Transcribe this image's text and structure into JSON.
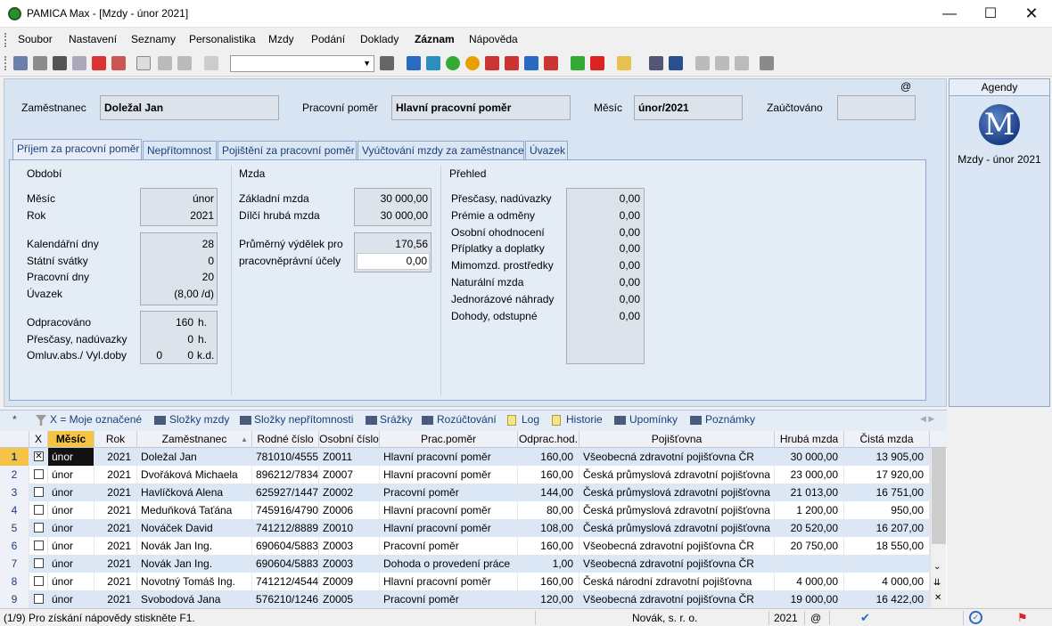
{
  "window": {
    "title": "PAMICA Max - [Mzdy - únor 2021]"
  },
  "menu": [
    "Soubor",
    "Nastavení",
    "Seznamy",
    "Personalistika",
    "Mzdy",
    "Podání",
    "Doklady",
    "Záznam",
    "Nápověda"
  ],
  "header": {
    "employee_label": "Zaměstnanec",
    "employee_value": "Doležal Jan",
    "relation_label": "Pracovní poměr",
    "relation_value": "Hlavní pracovní poměr",
    "month_label": "Měsíc",
    "month_value": "únor/2021",
    "posted_label": "Zaúčtováno",
    "posted_value": "",
    "at_sign": "@"
  },
  "tabs": [
    "Příjem za pracovní poměr",
    "Nepřítomnost",
    "Pojištění za pracovní poměr",
    "Vyúčtování mzdy za zaměstnance",
    "Úvazek"
  ],
  "obdobi": {
    "title": "Období",
    "mesic_label": "Měsíc",
    "mesic_value": "únor",
    "rok_label": "Rok",
    "rok_value": "2021",
    "kal_label": "Kalendářní dny",
    "kal_value": "28",
    "svatky_label": "Státní svátky",
    "svatky_value": "0",
    "prac_label": "Pracovní dny",
    "prac_value": "20",
    "uvazek_label": "Úvazek",
    "uvazek_value": "(8,00 /d)",
    "odprac_label": "Odpracováno",
    "odprac_value": "160",
    "odprac_unit": "h.",
    "presc_label": "Přesčasy, nadúvazky",
    "presc_value": "0",
    "presc_unit": "h.",
    "omluv_label": "Omluv.abs./ Vyl.doby",
    "omluv_value1": "0",
    "omluv_value2": "0",
    "omluv_unit": "k.d."
  },
  "mzda": {
    "title": "Mzda",
    "zakl_label": "Základní mzda",
    "zakl_value": "30 000,00",
    "dilci_label": "Dílčí hrubá mzda",
    "dilci_value": "30 000,00",
    "prum_label1": "Průměrný výdělek pro",
    "prum_label2": "pracovněprávní účely",
    "prum_value": "170,56",
    "prum_input": "0,00"
  },
  "prehled": {
    "title": "Přehled",
    "items": [
      {
        "label": "Přesčasy, nadúvazky",
        "value": "0,00"
      },
      {
        "label": "Prémie a odměny",
        "value": "0,00"
      },
      {
        "label": "Osobní ohodnocení",
        "value": "0,00"
      },
      {
        "label": "Příplatky a doplatky",
        "value": "0,00"
      },
      {
        "label": "Mimomzd. prostředky",
        "value": "0,00"
      },
      {
        "label": "Naturální mzda",
        "value": "0,00"
      },
      {
        "label": "Jednorázové náhrady",
        "value": "0,00"
      },
      {
        "label": "Dohody, odstupné",
        "value": "0,00"
      }
    ]
  },
  "agenda": {
    "title": "Agendy",
    "logo": "M",
    "item": "Mzdy - únor 2021"
  },
  "lower_tabs": [
    "*",
    "X = Moje označené",
    "Složky mzdy",
    "Složky nepřítomnosti",
    "Srážky",
    "Rozúčtování",
    "Log",
    "Historie",
    "Upomínky",
    "Poznámky"
  ],
  "grid": {
    "columns": [
      "X",
      "Měsíc",
      "Rok",
      "Zaměstnanec",
      "Rodné číslo",
      "Osobní číslo",
      "Prac.poměr",
      "Odprac.hod.",
      "Pojišťovna",
      "Hrubá mzda",
      "Čistá mzda"
    ],
    "rows": [
      {
        "n": "1",
        "x": "✕",
        "mesic": "únor",
        "rok": "2021",
        "zam": "Doležal Jan",
        "rc": "781010/4555",
        "oc": "Z0011",
        "pp": "Hlavní pracovní poměr",
        "hod": "160,00",
        "poj": "Všeobecná zdravotní pojišťovna ČR",
        "hruba": "30 000,00",
        "cista": "13 905,00"
      },
      {
        "n": "2",
        "x": "",
        "mesic": "únor",
        "rok": "2021",
        "zam": "Dvořáková Michaela",
        "rc": "896212/7834",
        "oc": "Z0007",
        "pp": "Hlavní pracovní poměr",
        "hod": "160,00",
        "poj": "Česká průmyslová zdravotní pojišťovna",
        "hruba": "23 000,00",
        "cista": "17 920,00"
      },
      {
        "n": "3",
        "x": "",
        "mesic": "únor",
        "rok": "2021",
        "zam": "Havlíčková Alena",
        "rc": "625927/1447",
        "oc": "Z0002",
        "pp": "Pracovní poměr",
        "hod": "144,00",
        "poj": "Česká průmyslová zdravotní pojišťovna",
        "hruba": "21 013,00",
        "cista": "16 751,00"
      },
      {
        "n": "4",
        "x": "",
        "mesic": "únor",
        "rok": "2021",
        "zam": "Meduňková Taťána",
        "rc": "745916/4790",
        "oc": "Z0006",
        "pp": "Hlavní pracovní poměr",
        "hod": "80,00",
        "poj": "Česká průmyslová zdravotní pojišťovna",
        "hruba": "1 200,00",
        "cista": "950,00"
      },
      {
        "n": "5",
        "x": "",
        "mesic": "únor",
        "rok": "2021",
        "zam": "Nováček David",
        "rc": "741212/8889",
        "oc": "Z0010",
        "pp": "Hlavní pracovní poměr",
        "hod": "108,00",
        "poj": "Česká průmyslová zdravotní pojišťovna",
        "hruba": "20 520,00",
        "cista": "16 207,00"
      },
      {
        "n": "6",
        "x": "",
        "mesic": "únor",
        "rok": "2021",
        "zam": "Novák Jan Ing.",
        "rc": "690604/5883",
        "oc": "Z0003",
        "pp": "Pracovní poměr",
        "hod": "160,00",
        "poj": "Všeobecná zdravotní pojišťovna ČR",
        "hruba": "20 750,00",
        "cista": "18 550,00"
      },
      {
        "n": "7",
        "x": "",
        "mesic": "únor",
        "rok": "2021",
        "zam": "Novák Jan Ing.",
        "rc": "690604/5883",
        "oc": "Z0003",
        "pp": "Dohoda o provedení práce",
        "hod": "1,00",
        "poj": "Všeobecná zdravotní pojišťovna ČR",
        "hruba": "",
        "cista": ""
      },
      {
        "n": "8",
        "x": "",
        "mesic": "únor",
        "rok": "2021",
        "zam": "Novotný Tomáš Ing.",
        "rc": "741212/4544",
        "oc": "Z0009",
        "pp": "Hlavní pracovní poměr",
        "hod": "160,00",
        "poj": "Česká národní zdravotní pojišťovna",
        "hruba": "4 000,00",
        "cista": "4 000,00"
      },
      {
        "n": "9",
        "x": "",
        "mesic": "únor",
        "rok": "2021",
        "zam": "Svobodová Jana",
        "rc": "576210/1246",
        "oc": "Z0005",
        "pp": "Pracovní poměr",
        "hod": "120,00",
        "poj": "Všeobecná zdravotní pojišťovna ČR",
        "hruba": "19 000,00",
        "cista": "16 422,00"
      }
    ]
  },
  "status": {
    "help": "(1/9) Pro získání nápovědy stiskněte F1.",
    "company": "Novák, s. r. o.",
    "year": "2021",
    "at": "@"
  }
}
